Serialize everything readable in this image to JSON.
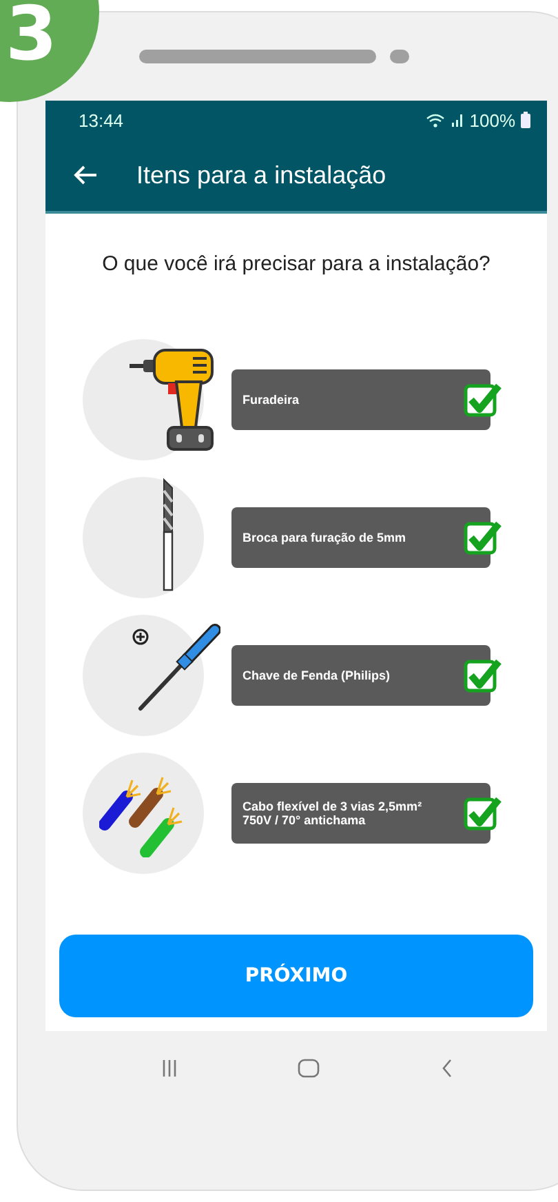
{
  "step_badge": "3",
  "status_bar": {
    "time": "13:44",
    "battery": "100%"
  },
  "app_bar": {
    "title": "Itens para a instalação"
  },
  "question": "O que você irá precisar para a instalação?",
  "items": [
    {
      "label": "Furadeira",
      "checked": true
    },
    {
      "label": "Broca para furação de 5mm",
      "checked": true
    },
    {
      "label": "Chave de Fenda (Philips)",
      "checked": true
    },
    {
      "label": "Cabo flexível de 3 vias 2,5mm²\n750V / 70° antichama",
      "checked": true
    }
  ],
  "next_button": "PRÓXIMO"
}
